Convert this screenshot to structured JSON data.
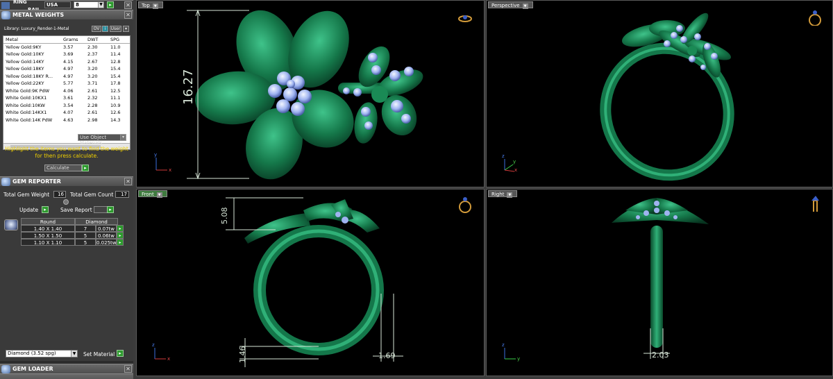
{
  "ring_rail": {
    "label_line1": "RING",
    "label_line2": "RAIL",
    "country": "USA",
    "size": "8",
    "go": "▸"
  },
  "metal_weights": {
    "title": "METAL WEIGHTS",
    "library": "Library: Luxury_Render-1-Metal",
    "btn_ov": "OV",
    "btn_user": "User",
    "columns": [
      "Metal",
      "Grams",
      "DWT",
      "SPG"
    ],
    "rows": [
      [
        "Yellow Gold:9KY",
        "3.57",
        "2.30",
        "11.0"
      ],
      [
        "Yellow Gold:10KY",
        "3.69",
        "2.37",
        "11.4"
      ],
      [
        "Yellow Gold:14KY",
        "4.15",
        "2.67",
        "12.8"
      ],
      [
        "Yellow Gold:18KY",
        "4.97",
        "3.20",
        "15.4"
      ],
      [
        "Yellow Gold:18KY R...",
        "4.97",
        "3.20",
        "15.4"
      ],
      [
        "Yellow Gold:22KY",
        "5.77",
        "3.71",
        "17.8"
      ],
      [
        "White Gold:9K PdW",
        "4.06",
        "2.61",
        "12.5"
      ],
      [
        "White Gold:10KX1",
        "3.61",
        "2.32",
        "11.1"
      ],
      [
        "White Gold:10KW",
        "3.54",
        "2.28",
        "10.9"
      ],
      [
        "White Gold:14KX1",
        "4.07",
        "2.61",
        "12.6"
      ],
      [
        "White Gold:14K PdW",
        "4.63",
        "2.98",
        "14.3"
      ]
    ],
    "use_object_materials": "Use Object Materials",
    "note": "Highlight the items you want to find the weight for then press calculate.",
    "calculate": "Calculate"
  },
  "gem_reporter": {
    "title": "GEM REPORTER",
    "total_weight_label": "Total Gem Weight",
    "total_weight": "16",
    "total_count_label": "Total Gem Count",
    "total_count": "17",
    "update": "Update",
    "save_report": "Save Report",
    "headers": [
      "Round",
      "Diamond"
    ],
    "rows": [
      [
        "1.40 X 1.40",
        "7",
        "0.07tw"
      ],
      [
        "1.50 X 1.50",
        "5",
        "0.06tw"
      ],
      [
        "1.10 X 1.10",
        "5",
        "0.025tw"
      ]
    ],
    "material": "Diamond   (3.52 spg)",
    "set_material": "Set Material"
  },
  "gem_loader": {
    "title": "GEM LOADER"
  },
  "views": {
    "top": {
      "label": "Top",
      "dim": "16.27",
      "axis_y": "y",
      "axis_x": "x"
    },
    "perspective": {
      "label": "Perspective",
      "axis_z": "z",
      "axis_y": "y",
      "axis_x": "x"
    },
    "front": {
      "label": "Front",
      "dim_a": "5.08",
      "dim_b": "1.46",
      "dim_c": "1.69",
      "axis_z": "z",
      "axis_x": "x"
    },
    "right": {
      "label": "Right",
      "dim": "2.03",
      "axis_z": "z",
      "axis_y": "y"
    }
  },
  "colors": {
    "metal": "#1f8a5a",
    "gem": "#9fb3f0",
    "dim": "#d8e6d8",
    "note": "#f0d000"
  }
}
